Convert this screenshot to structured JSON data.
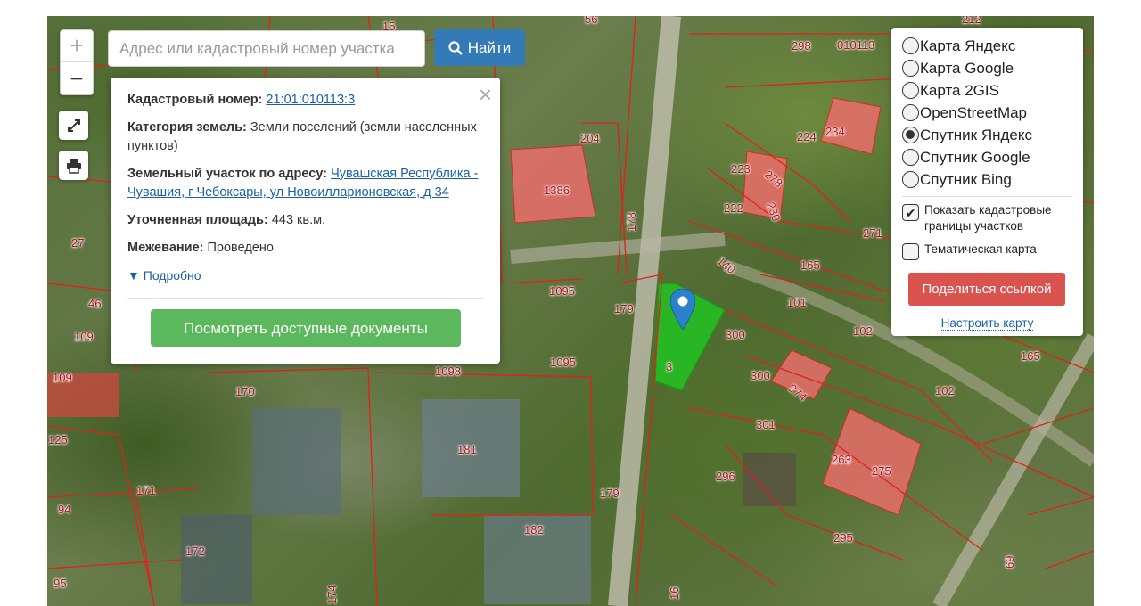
{
  "map": {
    "plot_labels": [
      "15",
      "56",
      "212",
      "298",
      "010113",
      "234",
      "224",
      "204",
      "1386",
      "278",
      "223",
      "230",
      "222",
      "178",
      "271",
      "27",
      "140",
      "165",
      "46",
      "1095",
      "179",
      "101",
      "109",
      "300",
      "102",
      "1098",
      "1095",
      "3",
      "109",
      "170",
      "300",
      "274",
      "165",
      "102",
      "125",
      "301",
      "181",
      "263",
      "275",
      "296",
      "171",
      "179",
      "94",
      "172",
      "182",
      "295",
      "95",
      "174",
      "16",
      "69"
    ]
  },
  "zoom": {
    "in_label": "+",
    "out_label": "−"
  },
  "search": {
    "placeholder": "Адрес или кадастровый номер участка",
    "button_label": "Найти"
  },
  "popup": {
    "cadastral_label": "Кадастровый номер:",
    "cadastral_value": "21:01:010113:3",
    "category_label": "Категория земель:",
    "category_value": "Земли поселений (земли населенных пунктов)",
    "address_label": "Земельный участок по адресу:",
    "address_value": "Чувашская Республика - Чувашия, г Чебоксары, ул Новоилларионовская, д 34",
    "area_label": "Уточненная площадь:",
    "area_value": "443 кв.м.",
    "survey_label": "Межевание:",
    "survey_value": "Проведено",
    "more_label": "Подробно",
    "docs_button": "Посмотреть доступные документы",
    "close_symbol": "×"
  },
  "layers": {
    "options": [
      {
        "label": "Карта Яндекс",
        "selected": false
      },
      {
        "label": "Карта Google",
        "selected": false
      },
      {
        "label": "Карта 2GIS",
        "selected": false
      },
      {
        "label": "OpenStreetMap",
        "selected": false
      },
      {
        "label": "Спутник Яндекс",
        "selected": true
      },
      {
        "label": "Спутник Google",
        "selected": false
      },
      {
        "label": "Спутник Bing",
        "selected": false
      }
    ],
    "show_boundaries_label": "Показать кадастровые границы участков",
    "show_boundaries_checked": true,
    "thematic_label": "Тематическая карта",
    "thematic_checked": false,
    "share_button": "Поделиться ссылкой",
    "config_link": "Настроить карту"
  },
  "colors": {
    "accent_blue": "#337ab7",
    "docs_green": "#5cb85c",
    "share_red": "#d9534f",
    "parcel_green": "#22c322",
    "boundary_red": "#e3201b"
  }
}
